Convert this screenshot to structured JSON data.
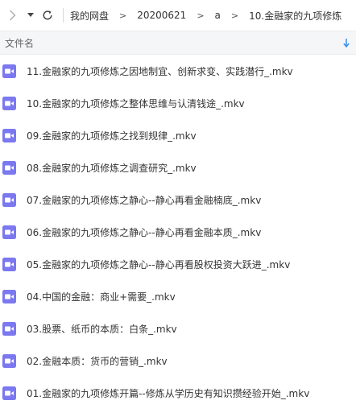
{
  "toolbar": {
    "forward_icon": "chevron-right-icon",
    "dropdown_icon": "caret-down-icon",
    "refresh_icon": "refresh-icon"
  },
  "breadcrumb": [
    "我的网盘",
    "20200621",
    "a",
    "10.金融家的九项修炼"
  ],
  "breadcrumb_separator": ">",
  "header": {
    "label": "文件名",
    "sort_icon": "sort-down-arrow-icon"
  },
  "colors": {
    "video_icon": "#7b78f0",
    "sort_arrow": "#3a8ef0",
    "header_bg": "#f5f6f8"
  },
  "files": [
    {
      "name": "11.金融家的九项修炼之因地制宜、创新求变、实践潜行_.mkv",
      "icon": "video-file-icon"
    },
    {
      "name": "10.金融家的九项修炼之整体思维与认清钱途_.mkv",
      "icon": "video-file-icon"
    },
    {
      "name": "09.金融家的九项修炼之找到规律_.mkv",
      "icon": "video-file-icon"
    },
    {
      "name": "08.金融家的九项修炼之调查研究_.mkv",
      "icon": "video-file-icon"
    },
    {
      "name": "07.金融家的九项修炼之静心--静心再看金融楠底_.mkv",
      "icon": "video-file-icon"
    },
    {
      "name": "06.金融家的九项修炼之静心--静心再看金融本质_.mkv",
      "icon": "video-file-icon"
    },
    {
      "name": "05.金融家的九项修炼之静心--静心再看股权投资大跃进_.mkv",
      "icon": "video-file-icon"
    },
    {
      "name": "04.中国的金融：商业+需要_.mkv",
      "icon": "video-file-icon"
    },
    {
      "name": "03.股票、纸币的本质：白条_.mkv",
      "icon": "video-file-icon"
    },
    {
      "name": "02.金融本质：货币的营销_.mkv",
      "icon": "video-file-icon"
    },
    {
      "name": "01.金融家的九项修炼开篇--修炼从学历史有知识攒经验开始_.mkv",
      "icon": "video-file-icon"
    }
  ]
}
